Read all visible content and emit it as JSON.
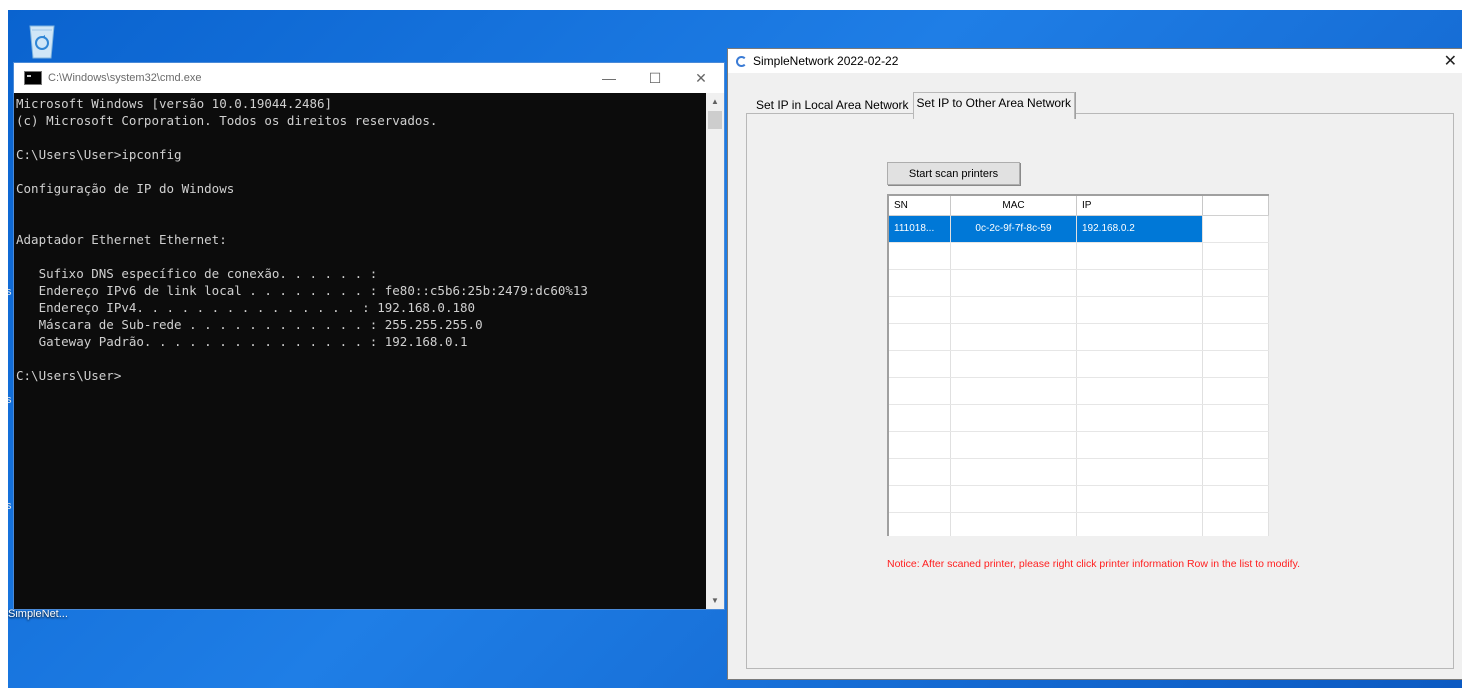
{
  "desktop": {
    "recycle_bin_icon": "recycle-bin-icon",
    "shortcut_label": "SimpleNet...",
    "edge_letters": [
      "s",
      "s",
      "s"
    ]
  },
  "cmd_window": {
    "title": "C:\\Windows\\system32\\cmd.exe",
    "controls": {
      "minimize": "—",
      "maximize": "☐",
      "close": "✕"
    },
    "console_lines": [
      "Microsoft Windows [versão 10.0.19044.2486]",
      "(c) Microsoft Corporation. Todos os direitos reservados.",
      "",
      "C:\\Users\\User>ipconfig",
      "",
      "Configuração de IP do Windows",
      "",
      "",
      "Adaptador Ethernet Ethernet:",
      "",
      "   Sufixo DNS específico de conexão. . . . . . :",
      "   Endereço IPv6 de link local . . . . . . . . : fe80::c5b6:25b:2479:dc60%13",
      "   Endereço IPv4. . . . . . . . . . . . . . . : 192.168.0.180",
      "   Máscara de Sub-rede . . . . . . . . . . . . : 255.255.255.0",
      "   Gateway Padrão. . . . . . . . . . . . . . . : 192.168.0.1",
      "",
      "C:\\Users\\User>"
    ],
    "scroll_up": "▲",
    "scroll_down": "▼"
  },
  "simplenetwork": {
    "title": "SimpleNetwork 2022-02-22",
    "close": "✕",
    "tabs": [
      {
        "label": "Set IP in Local Area Network",
        "active": false
      },
      {
        "label": "Set IP to Other Area Network",
        "active": true
      }
    ],
    "scan_button": "Start scan printers",
    "columns": [
      "SN",
      "MAC",
      "IP",
      ""
    ],
    "rows": [
      {
        "sn": "111018...",
        "mac": "0c-2c-9f-7f-8c-59",
        "ip": "192.168.0.2",
        "selected": true
      }
    ],
    "notice": "Notice: After scaned printer, please right click printer information Row in the list to modify."
  }
}
